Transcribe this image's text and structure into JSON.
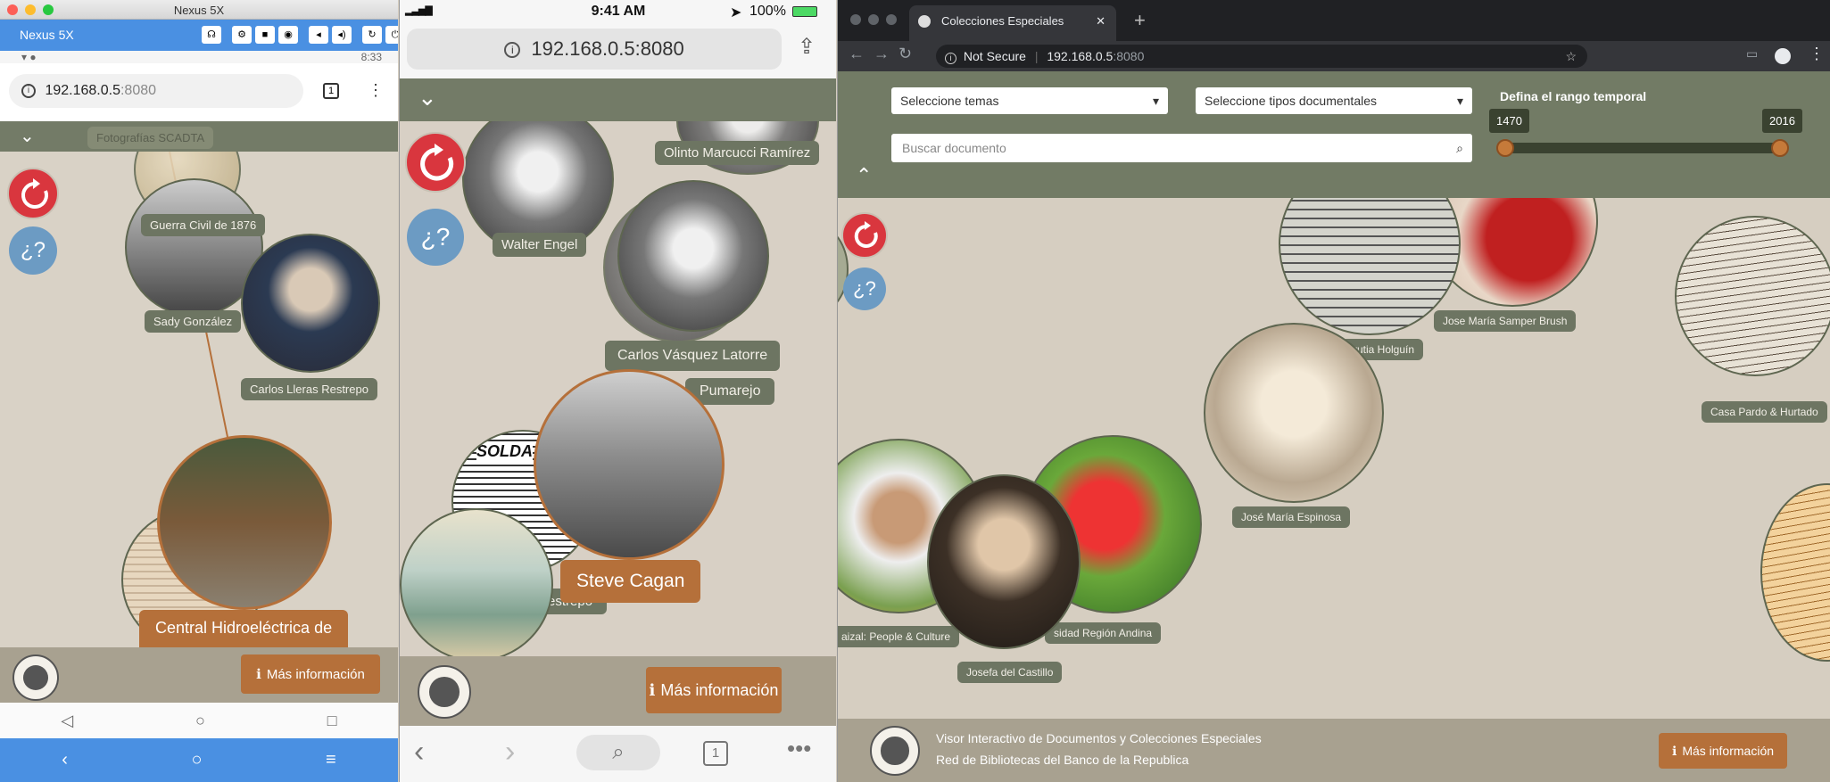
{
  "mac_window": {
    "title": "Nexus 5X"
  },
  "android": {
    "app_label": "Nexus 5X",
    "time": "8:33",
    "url_host": "192.168.0.5",
    "url_port": ":8080",
    "tab_count": "1"
  },
  "ios": {
    "time": "9:41 AM",
    "battery": "100%",
    "url": "192.168.0.5:8080",
    "tab_count": "1"
  },
  "desktop": {
    "tab_title": "Colecciones Especiales",
    "not_secure": "Not Secure",
    "url_host": "192.168.0.5",
    "url_port": ":8080",
    "select_temas": "Seleccione temas",
    "select_tipos": "Seleccione tipos documentales",
    "range_label": "Defina el rango temporal",
    "range_min": "1470",
    "range_max": "2016",
    "search_placeholder": "Buscar documento",
    "footer_line1": "Visor Interactivo de Documentos y Colecciones Especiales",
    "footer_line2": "Red de Bibliotecas del Banco de la Republica"
  },
  "labels": {
    "question": "¿?",
    "mas_info": "Más información"
  },
  "pane1_nodes": {
    "fotografias": "Fotografías SCADTA",
    "guerra": "Guerra Civil de 1876",
    "sady": "Sady González",
    "lleras": "Carlos Lleras Restrepo",
    "central": "Central Hidroeléctrica de"
  },
  "pane2_nodes": {
    "olinto": "Olinto Marcucci Ramírez",
    "walter": "Walter Engel",
    "vasquez": "Carlos Vásquez Latorre",
    "pumarejo": "Pumarejo",
    "estrepo": "estrepo",
    "cagan": "Steve Cagan",
    "news_word": "SOLDA"
  },
  "pane3_nodes": {
    "samper": "Jose María Samper Brush",
    "urrutia": "rrutia Holguín",
    "pardo": "Casa Pardo & Hurtado",
    "espinosa": "José María Espinosa",
    "raizal": "aizal: People & Culture",
    "andina": "sidad Región Andina",
    "castillo": "Josefa del Castillo"
  },
  "colors": {
    "olive": "#6d7562",
    "orange": "#b5703a",
    "red": "#d9363e",
    "blue": "#6c9bc3",
    "android_blue": "#4a90e2"
  }
}
